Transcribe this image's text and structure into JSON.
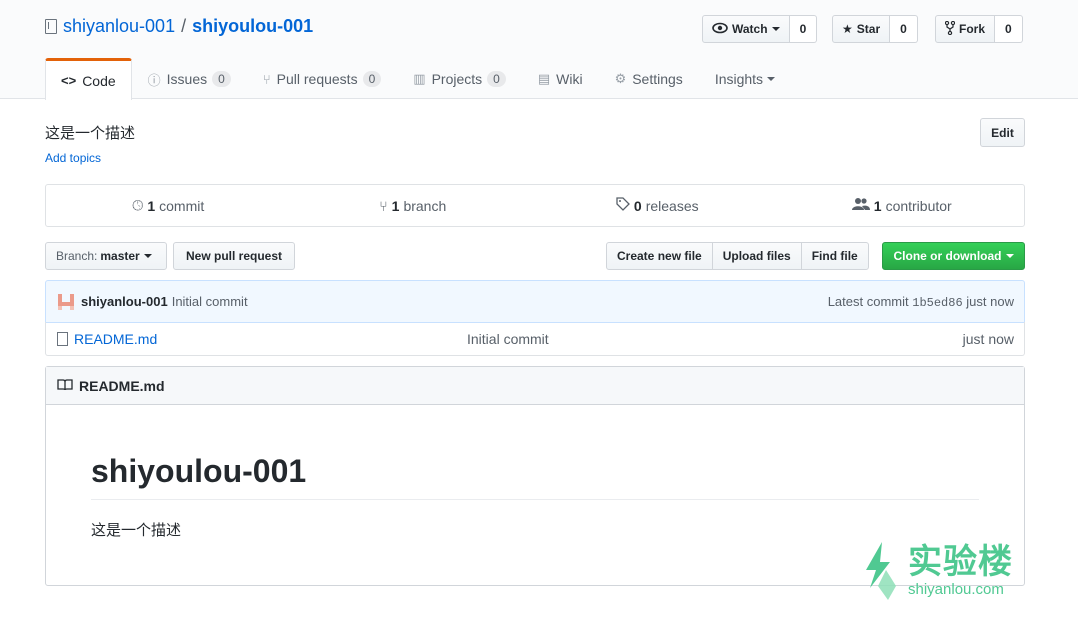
{
  "header": {
    "owner": "shiyanlou-001",
    "separator": "/",
    "repo": "shiyoulou-001",
    "watch": {
      "label": "Watch",
      "count": "0"
    },
    "star": {
      "label": "Star",
      "count": "0"
    },
    "fork": {
      "label": "Fork",
      "count": "0"
    }
  },
  "tabs": [
    {
      "label": "Code",
      "icon": "code-icon"
    },
    {
      "label": "Issues",
      "count": "0",
      "icon": "issue-icon"
    },
    {
      "label": "Pull requests",
      "count": "0",
      "icon": "pull-request-icon"
    },
    {
      "label": "Projects",
      "count": "0",
      "icon": "project-icon"
    },
    {
      "label": "Wiki",
      "icon": "book-icon"
    },
    {
      "label": "Settings",
      "icon": "gear-icon"
    },
    {
      "label": "Insights",
      "icon": ""
    }
  ],
  "description": "这是一个描述",
  "add_topics": "Add topics",
  "edit_label": "Edit",
  "summary": {
    "commits": {
      "num": "1",
      "label": "commit"
    },
    "branches": {
      "num": "1",
      "label": "branch"
    },
    "releases": {
      "num": "0",
      "label": "releases"
    },
    "contributors": {
      "num": "1",
      "label": "contributor"
    }
  },
  "file_nav": {
    "branch_prefix": "Branch:",
    "branch": "master",
    "new_pr": "New pull request",
    "create_file": "Create new file",
    "upload": "Upload files",
    "find": "Find file",
    "clone": "Clone or download"
  },
  "commit": {
    "author": "shiyanlou-001",
    "message": "Initial commit",
    "latest_prefix": "Latest commit",
    "sha": "1b5ed86",
    "age": "just now"
  },
  "files": [
    {
      "name": "README.md",
      "message": "Initial commit",
      "age": "just now"
    }
  ],
  "readme": {
    "title": "README.md",
    "heading": "shiyoulou-001",
    "body": "这是一个描述"
  },
  "watermark": {
    "cn": "实验楼",
    "en": "shiyanlou.com"
  },
  "colors": {
    "accent": "#0366d6",
    "green": "#28a745",
    "tab_active": "#e36209",
    "watermark": "#32c080"
  }
}
